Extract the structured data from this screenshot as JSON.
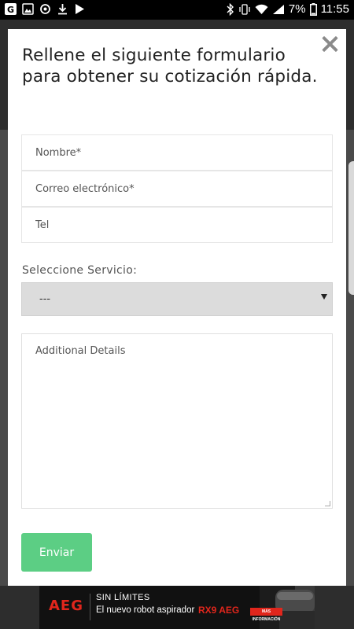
{
  "status_bar": {
    "left_icons": [
      "g-icon",
      "gallery-icon",
      "sync-icon",
      "download-icon",
      "play-store-icon"
    ],
    "battery": "7%",
    "time": "11:55"
  },
  "modal": {
    "title": "Rellene el siguiente formulario para obtener su cotización rápida.",
    "fields": {
      "name_placeholder": "Nombre*",
      "email_placeholder": "Correo electrónico*",
      "tel_placeholder": "Tel"
    },
    "service": {
      "label": "Seleccione Servicio:",
      "selected": "---"
    },
    "details_placeholder": "Additional Details",
    "submit_label": "Enviar"
  },
  "ad": {
    "brand": "AEG",
    "line1": "SIN LÍMITES",
    "line2": "El nuevo robot aspirador",
    "product": "RX9 AEG",
    "cta": "MÁS INFORMACIÓN"
  },
  "colors": {
    "submit_green": "#5cce84",
    "select_gray": "#dcdcdc",
    "ad_red": "#e1261c"
  }
}
